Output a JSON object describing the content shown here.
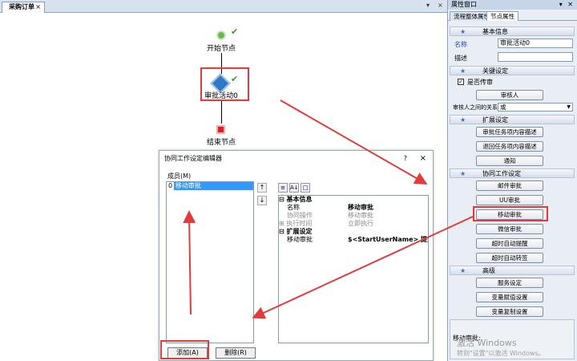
{
  "document": {
    "tab_label": "采购订单",
    "tab_close": "×",
    "tab_dropdown": "▾",
    "tab_close_all": "×"
  },
  "flow": {
    "start_label": "开始节点",
    "approve_label": "审批活动0",
    "end_label": "结束节点",
    "check_mark": "✔"
  },
  "dialog": {
    "title": "协同工作设定编辑器",
    "help": "?",
    "close": "×",
    "members_label": "成员(M)",
    "members": [
      {
        "index": "0",
        "name": "移动审批"
      }
    ],
    "move_up": "↑",
    "move_down": "↓",
    "toolbar": [
      "≡",
      "A↓",
      "□"
    ],
    "properties": [
      {
        "type": "cat",
        "toggle": "⊟",
        "key": "基本信息",
        "value": ""
      },
      {
        "type": "row",
        "key": "名称",
        "value": "移动审批",
        "bold": true
      },
      {
        "type": "gray",
        "key": "协同操作",
        "value": "移动审批"
      },
      {
        "type": "gray",
        "toggle": "⊞",
        "key": "执行时间",
        "value": "立即执行"
      },
      {
        "type": "cat",
        "toggle": "⊟",
        "key": "扩展设定",
        "value": ""
      },
      {
        "type": "row",
        "key": "移动审批",
        "value": "$<StartUserName> 提交的",
        "bold": true
      }
    ],
    "add_button": "添加(A)",
    "delete_button": "删除(R)"
  },
  "panel": {
    "title": "属性窗口",
    "title_controls": "▾ ✕",
    "tabs": [
      "流程整体属性",
      "节点属性"
    ],
    "active_tab": 1,
    "sections": {
      "basic": "基本信息",
      "key": "关键设定",
      "ext": "扩展设定",
      "cowork": "协同工作设定",
      "advanced": "高级"
    },
    "name_label": "名称",
    "name_value": "审批活动0",
    "desc_label": "描述",
    "desc_value": "",
    "is_approve": "是否传审",
    "is_approve_checked": "✓",
    "approver_button": "审核人",
    "relation_label": "审核人之间的关系",
    "relation_value": "或",
    "ext_buttons": [
      "审批任务项内容描述",
      "退回任务项内容描述",
      "通知"
    ],
    "cowork_buttons": [
      "邮件审批",
      "UU审批",
      "移动审批",
      "微信审批",
      "超时自动提醒",
      "超时自动转签"
    ],
    "advanced_buttons": [
      "服务设定",
      "变量赋值设置",
      "变量复制设置"
    ],
    "description_caption": "移动审批:"
  },
  "watermark": {
    "line1": "激活 Windows",
    "line2": "转到\"设置\"以激活 Windows。"
  },
  "colors": {
    "highlight_red": "#e23b3b",
    "selection_blue": "#3399ff",
    "panel_bg": "#e9eef5"
  }
}
